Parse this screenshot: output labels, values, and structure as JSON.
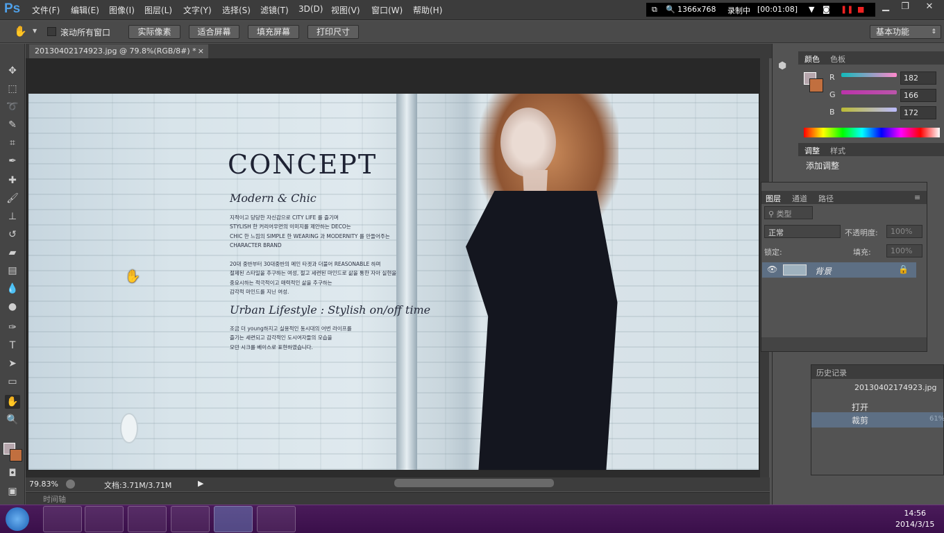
{
  "app": {
    "logo": "Ps"
  },
  "menu": [
    "文件(F)",
    "编辑(E)",
    "图像(I)",
    "图层(L)",
    "文字(Y)",
    "选择(S)",
    "滤镜(T)",
    "3D(D)",
    "视图(V)",
    "窗口(W)",
    "帮助(H)"
  ],
  "recorder": {
    "resolution": "1366x768",
    "status": "录制中",
    "timer": "[00:01:08]"
  },
  "options": {
    "scroll_all": "滚动所有窗口",
    "actual_pixels": "实际像素",
    "fit_screen": "适合屏幕",
    "fill_screen": "填充屏幕",
    "print_size": "打印尺寸",
    "workspace": "基本功能"
  },
  "document": {
    "tab_title": "20130402174923.jpg @ 79.8%(RGB/8#) *",
    "zoom": "79.83%",
    "doc_size": "文档:3.71M/3.71M",
    "timeline": "时间轴"
  },
  "artwork": {
    "title": "CONCEPT",
    "subtitle1": "Modern & Chic",
    "para1": "지적이고 당당한 자신감으로 CITY LIFE 를 즐기며\nSTYLISH 한 커리어우먼의 이미지를 제안하는 DECO는\nCHIC 한 느낌의 SIMPLE 한 WEARING 과 MODERNITY 를 만들어주는\nCHARACTER BRAND",
    "para2": "20대 중반부터 30대중반의 메인 타겟과 더불어 REASONABLE 하며\n절제된 스타일을 추구하는 여성, 절고 세련된 마인드로 삶을 통한 자아 실현을\n중요시하는 적극적이고 매력적인 삶을 추구하는\n감각적 마인드를 지닌 여성.",
    "subtitle2": "Urban Lifestyle : Stylish on/off time",
    "para3": "조금 더 young하지고 실용적인 동시대의 어번 라이프를\n즐기는 세련되고 감각적인 도시여자들의 모습을\n모던 시크를 베이스로 표현하였습니다."
  },
  "color_panel": {
    "tab1": "颜色",
    "tab2": "色板",
    "r_label": "R",
    "g_label": "G",
    "b_label": "B",
    "r": "182",
    "g": "166",
    "b": "172",
    "fg": "#b6a6ac",
    "bg": "#c16f3f"
  },
  "adjust_panel": {
    "tab1": "调整",
    "tab2": "样式",
    "add": "添加调整"
  },
  "layers_panel": {
    "tab1": "图层",
    "tab2": "通道",
    "tab3": "路径",
    "kind": "类型",
    "blend": "正常",
    "opacity_label": "不透明度:",
    "opacity": "100%",
    "lock_label": "锁定:",
    "fill_label": "填充:",
    "fill": "100%",
    "layer_name": "背景"
  },
  "history_panel": {
    "tab": "历史记录",
    "snapshot": "20130402174923.jpg",
    "items": [
      "打开",
      "裁剪"
    ],
    "badge": "61%"
  },
  "taskbar": {
    "time": "14:56",
    "date": "2014/3/15"
  }
}
